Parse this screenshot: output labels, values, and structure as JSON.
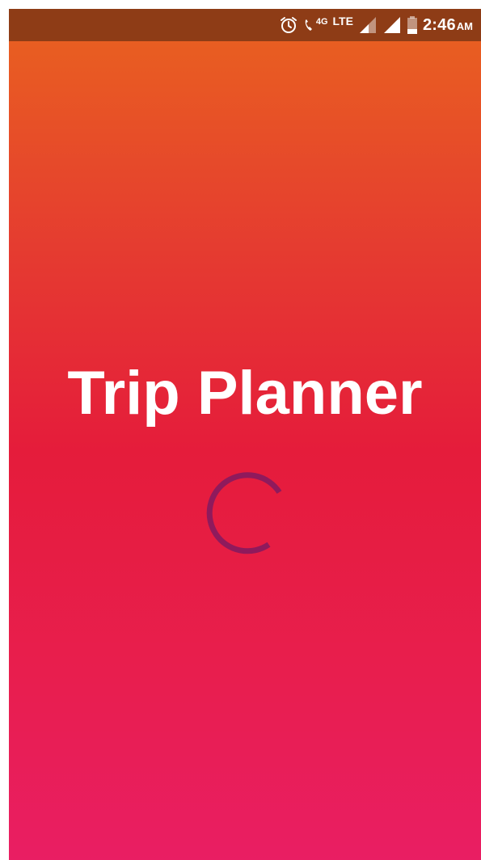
{
  "status_bar": {
    "network_4g_label": "4G",
    "lte_label": "LTE",
    "time": "2:46",
    "am_pm": "AM",
    "icons": [
      "alarm-icon",
      "wifi-call-icon",
      "signal-icon",
      "signal-icon",
      "battery-icon"
    ]
  },
  "splash": {
    "title": "Trip Planner",
    "loading_indicator": "progress-spinner"
  },
  "colors": {
    "status_bar": "#8e3c16",
    "gradient_top": "#e9631f",
    "gradient_middle": "#e51c3b",
    "gradient_bottom": "#e91e63",
    "spinner": "#8f1a5c",
    "title_text": "#ffffff"
  }
}
